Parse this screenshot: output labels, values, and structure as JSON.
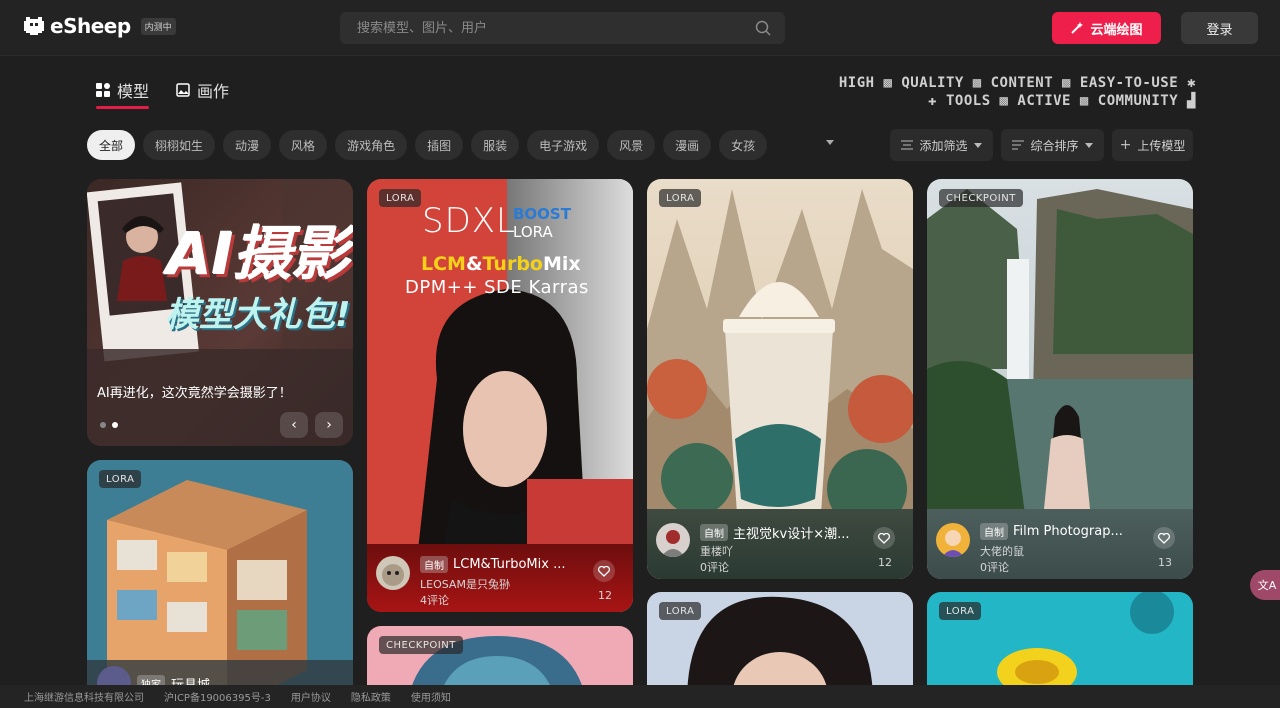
{
  "header": {
    "logo_text": "eSheep",
    "beta_label": "内测中",
    "search_placeholder": "搜索模型、图片、用户",
    "cloud_button": "云端绘图",
    "login_button": "登录"
  },
  "tabs": [
    {
      "label": "模型",
      "active": true
    },
    {
      "label": "画作",
      "active": false
    }
  ],
  "slogan": {
    "line1": "HIGH ▩ QUALITY ▩ CONTENT ▩ EASY-TO-USE ✱",
    "line2": "✚ TOOLS ▩ ACTIVE ▩ COMMUNITY ▟"
  },
  "chips": [
    "全部",
    "栩栩如生",
    "动漫",
    "风格",
    "游戏角色",
    "插图",
    "服装",
    "电子游戏",
    "风景",
    "漫画",
    "女孩"
  ],
  "tools": {
    "filter_label": "添加筛选",
    "sort_label": "综合排序",
    "upload_label": "上传模型"
  },
  "banner": {
    "headline": "AI摄影",
    "subline": "模型大礼包!",
    "caption": "AI再进化，这次竟然学会摄影了！",
    "prev": "‹",
    "next": "›"
  },
  "cards": [
    {
      "badge": "LORA",
      "sdxl": "SDXL",
      "boost": "BOOST",
      "lora_word": "LORA",
      "line_a1": "LCM",
      "line_a2": "&",
      "line_a3": "Turbo",
      "line_a4": "Mix",
      "line_b": "DPM++ SDE Karras",
      "tag": "自制",
      "title": "LCM&TurboMix ...",
      "author": "LEOSAM是只兔狲",
      "comments": "4评论",
      "likes": "12"
    },
    {
      "badge": "LORA",
      "tag": "自制",
      "title": "主视觉kv设计×潮...",
      "author": "重楼吖",
      "comments": "0评论",
      "likes": "12"
    },
    {
      "badge": "CHECKPOINT",
      "tag": "自制",
      "title": "Film Photograp...",
      "author": "大佬的鼠",
      "comments": "0评论",
      "likes": "13"
    },
    {
      "badge": "LORA",
      "tag": "独家",
      "title": "玩具城"
    },
    {
      "badge": "CHECKPOINT"
    },
    {
      "badge": "LORA"
    },
    {
      "badge": "LORA"
    }
  ],
  "footer": [
    "上海继游信息科技有限公司",
    "沪ICP备19006395号-3",
    "用户协议",
    "隐私政策",
    "使用须知"
  ],
  "translate_label": "文A"
}
